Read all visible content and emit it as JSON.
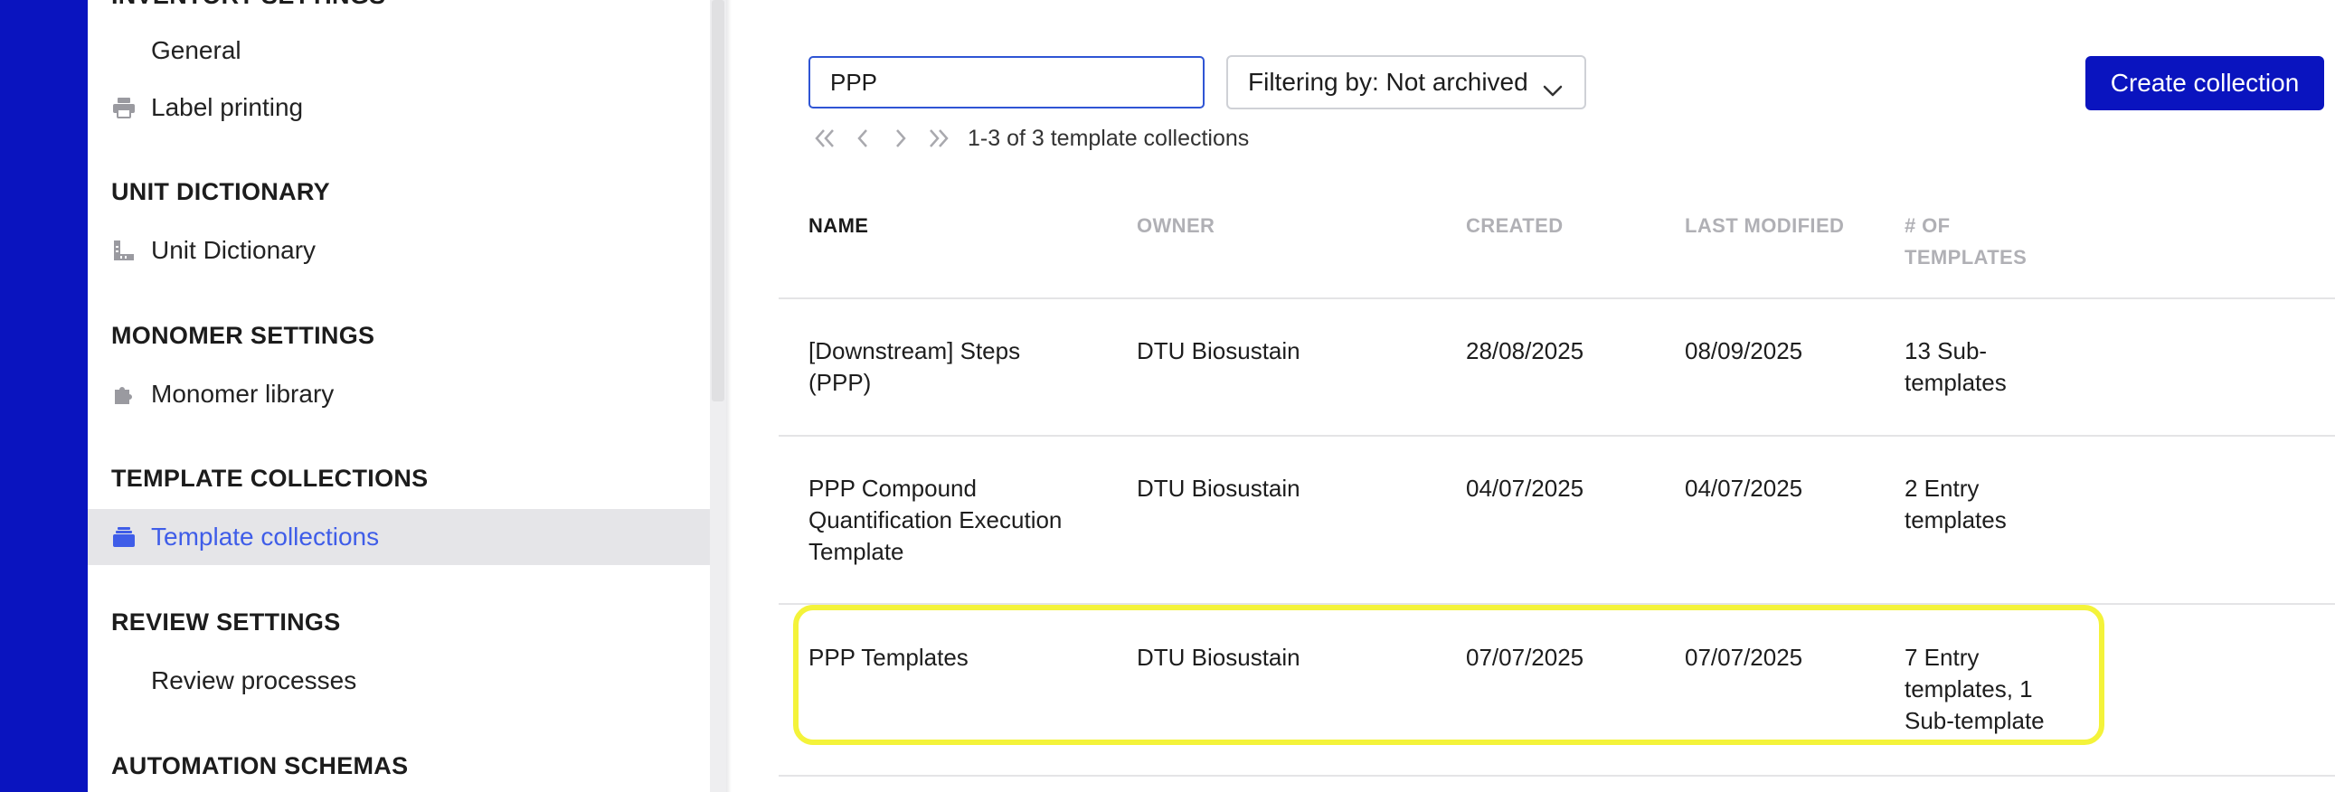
{
  "sidebar": {
    "partial_heading": "INVENTORY SETTINGS",
    "sections": [
      {
        "heading": null,
        "items": [
          {
            "label": "General",
            "icon": "none"
          },
          {
            "label": "Label printing",
            "icon": "printer-icon"
          }
        ]
      },
      {
        "heading": "UNIT DICTIONARY",
        "items": [
          {
            "label": "Unit Dictionary",
            "icon": "ruler-icon"
          }
        ]
      },
      {
        "heading": "MONOMER SETTINGS",
        "items": [
          {
            "label": "Monomer library",
            "icon": "puzzle-icon"
          }
        ]
      },
      {
        "heading": "TEMPLATE COLLECTIONS",
        "items": [
          {
            "label": "Template collections",
            "icon": "stack-icon",
            "active": true
          }
        ]
      },
      {
        "heading": "REVIEW SETTINGS",
        "items": [
          {
            "label": "Review processes",
            "icon": "none"
          }
        ]
      },
      {
        "heading": "AUTOMATION SCHEMAS",
        "items": []
      }
    ]
  },
  "toolbar": {
    "search_value": "PPP",
    "filter_label": "Filtering by: Not archived",
    "create_label": "Create collection"
  },
  "pagination": {
    "summary": "1-3 of 3 template collections"
  },
  "table": {
    "headers": {
      "name": "NAME",
      "owner": "OWNER",
      "created": "CREATED",
      "last_modified": "LAST MODIFIED",
      "templates_line1": "# OF",
      "templates_line2": "TEMPLATES"
    },
    "rows": [
      {
        "name_lines": [
          "[Downstream] Steps",
          "(PPP)"
        ],
        "owner": "DTU Biosustain",
        "created": "28/08/2025",
        "modified": "08/09/2025",
        "count_lines": [
          "13 Sub-",
          "templates"
        ]
      },
      {
        "name_lines": [
          "PPP Compound",
          "Quantification Execution",
          "Template"
        ],
        "owner": "DTU Biosustain",
        "created": "04/07/2025",
        "modified": "04/07/2025",
        "count_lines": [
          "2 Entry",
          "templates"
        ]
      },
      {
        "name_lines": [
          "PPP Templates"
        ],
        "owner": "DTU Biosustain",
        "created": "07/07/2025",
        "modified": "07/07/2025",
        "count_lines": [
          "7 Entry",
          "templates, 1",
          "Sub-template"
        ]
      }
    ]
  },
  "colors": {
    "brand": "#0a14bf",
    "active_text": "#3f5de8",
    "highlight": "#f4f33a",
    "focus_border": "#2f55d4"
  }
}
